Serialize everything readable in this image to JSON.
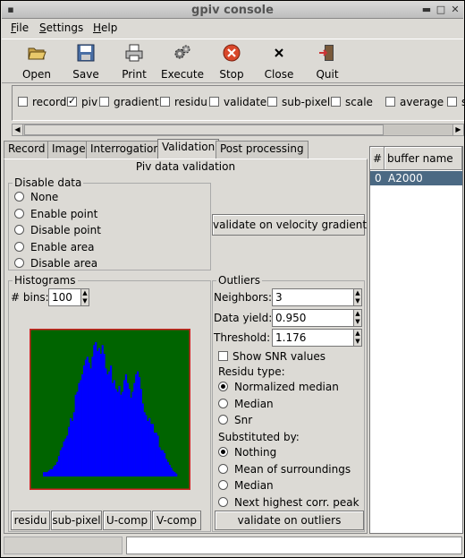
{
  "window": {
    "title": "gpiv console"
  },
  "menu": [
    {
      "label": "File",
      "mnemonic": "F",
      "rest": "ile"
    },
    {
      "label": "Settings",
      "mnemonic": "S",
      "rest": "ettings"
    },
    {
      "label": "Help",
      "mnemonic": "H",
      "rest": "elp"
    }
  ],
  "toolbar": [
    {
      "label": "Open",
      "icon": "folder-open-icon"
    },
    {
      "label": "Save",
      "icon": "floppy-disk-icon"
    },
    {
      "label": "Print",
      "icon": "printer-icon"
    },
    {
      "label": "Execute",
      "icon": "gears-icon"
    },
    {
      "label": "Stop",
      "icon": "stop-icon"
    },
    {
      "label": "Close",
      "icon": "close-x-icon"
    },
    {
      "label": "Quit",
      "icon": "exit-door-icon"
    }
  ],
  "process_options": [
    {
      "label": "record",
      "checked": false
    },
    {
      "label": "piv",
      "checked": true
    },
    {
      "label": "gradient",
      "checked": false
    },
    {
      "label": "residu",
      "checked": false
    },
    {
      "label": "validate",
      "checked": false
    },
    {
      "label": "sub-pixel",
      "checked": false
    },
    {
      "label": "scale",
      "checked": false
    },
    {
      "label": "average",
      "checked": false
    },
    {
      "label": "su",
      "checked": false
    }
  ],
  "tabs": [
    "Record",
    "Image",
    "Interrogation",
    "Validation",
    "Post processing"
  ],
  "active_tab": "Validation",
  "validation": {
    "heading": "Piv data validation",
    "disable_data": {
      "label": "Disable data",
      "options": [
        "None",
        "Enable point",
        "Disable point",
        "Enable area",
        "Disable area"
      ],
      "selected": null
    },
    "gradient_button": "validate on velocity gradient",
    "histograms": {
      "label": "Histograms",
      "bins_label": "# bins:",
      "bins_value": "100",
      "buttons": [
        "residu",
        "sub-pixel",
        "U-comp",
        "V-comp"
      ],
      "colors": {
        "background": "#006400",
        "bars": "#0000ff",
        "border": "#d02020"
      }
    },
    "outliers": {
      "label": "Outliers",
      "fields": [
        {
          "label": "Neighbors:",
          "value": "3"
        },
        {
          "label": "Data yield:",
          "value": "0.950"
        },
        {
          "label": "Threshold:",
          "value": "1.176"
        }
      ],
      "show_snr": {
        "label": "Show SNR values",
        "checked": false
      },
      "residu_type": {
        "label": "Residu type:",
        "options": [
          "Normalized median",
          "Median",
          "Snr"
        ],
        "selected": 0
      },
      "substituted_by": {
        "label": "Substituted by:",
        "options": [
          "Nothing",
          "Mean of surroundings",
          "Median",
          "Next highest corr. peak"
        ],
        "selected": 0
      },
      "button": "validate on outliers"
    }
  },
  "buffers": {
    "columns": [
      "#",
      "buffer name"
    ],
    "rows": [
      {
        "num": "0",
        "name": "A2000"
      }
    ]
  },
  "chart_data": {
    "type": "bar",
    "title": "",
    "xlabel": "",
    "ylabel": "",
    "bins": 100,
    "values": [
      3,
      3,
      3,
      4,
      5,
      5,
      7,
      8,
      10,
      14,
      18,
      20,
      24,
      26,
      28,
      34,
      40,
      38,
      44,
      56,
      58,
      64,
      66,
      70,
      76,
      80,
      82,
      78,
      74,
      82,
      90,
      92,
      86,
      88,
      84,
      90,
      84,
      74,
      70,
      72,
      76,
      64,
      66,
      60,
      58,
      62,
      56,
      58,
      66,
      70,
      64,
      60,
      54,
      58,
      64,
      70,
      72,
      68,
      60,
      50,
      44,
      42,
      38,
      40,
      36,
      36,
      30,
      30,
      28,
      20,
      18,
      18,
      16,
      12,
      10,
      8,
      6,
      4,
      3,
      2
    ]
  }
}
